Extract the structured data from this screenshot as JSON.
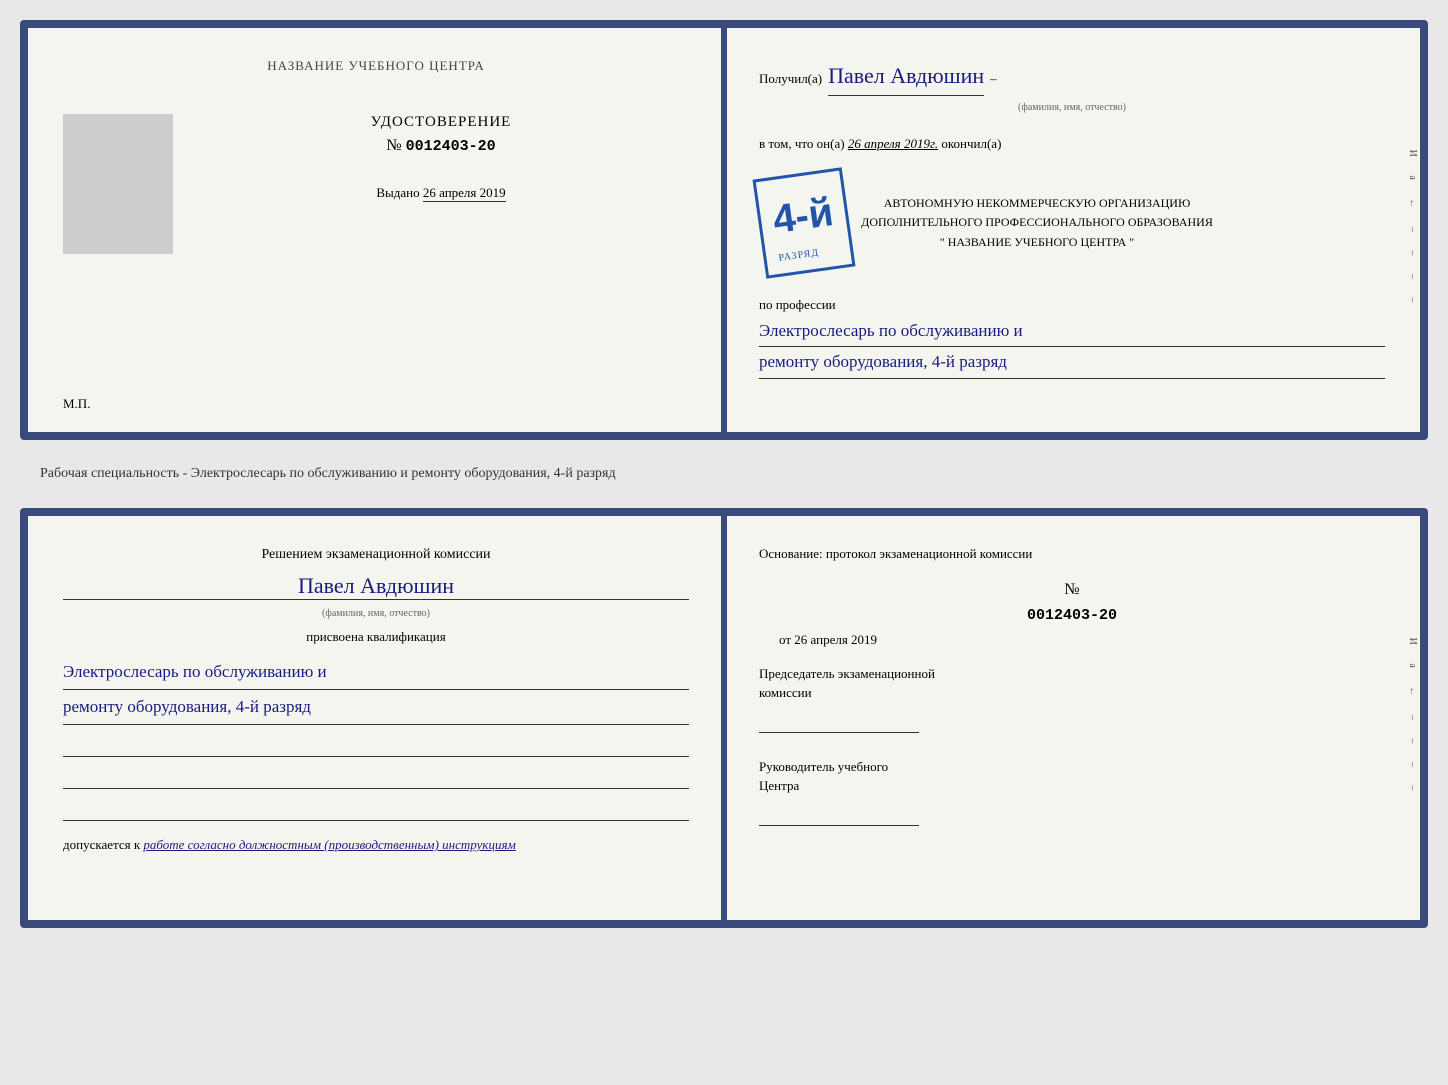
{
  "top_doc": {
    "left": {
      "title": "НАЗВАНИЕ УЧЕБНОГО ЦЕНТРА",
      "doc_type": "УДОСТОВЕРЕНИЕ",
      "doc_number_prefix": "№",
      "doc_number": "0012403-20",
      "vydano_label": "Выдано",
      "vydano_date": "26 апреля 2019",
      "mp_label": "М.П."
    },
    "right": {
      "poluchil_prefix": "Получил(a)",
      "recipient_name": "Павел Авдюшин",
      "fio_caption": "(фамилия, имя, отчество)",
      "vtom_prefix": "в том, что он(а)",
      "vtom_date": "26 апреля 2019г.",
      "okonchil": "окончил(а)",
      "stamp_number": "4-й",
      "stamp_suffix": "разряд",
      "org_line1": "АВТОНОМНУЮ НЕКОММЕРЧЕСКУЮ ОРГАНИЗАЦИЮ",
      "org_line2": "ДОПОЛНИТЕЛЬНОГО ПРОФЕССИОНАЛЬНОГО ОБРАЗОВАНИЯ",
      "org_line3": "\" НАЗВАНИЕ УЧЕБНОГО ЦЕНТРА \"",
      "po_professii_label": "по профессии",
      "profession_line1": "Электрослесарь по обслуживанию и",
      "profession_line2": "ремонту оборудования, 4-й разряд"
    }
  },
  "middle": {
    "text": "Рабочая специальность - Электрослесарь по обслуживанию и ремонту оборудования, 4-й разряд"
  },
  "bottom_doc": {
    "left": {
      "resheniem_line1": "Решением экзаменационной комиссии",
      "recipient_name": "Павел Авдюшин",
      "fio_caption": "(фамилия, имя, отчество)",
      "prisvoena_label": "присвоена квалификация",
      "qual_line1": "Электрослесарь по обслуживанию и",
      "qual_line2": "ремонту оборудования, 4-й разряд",
      "dopuskaetsya_prefix": "допускается к",
      "dopuskaetsya_value": "работе согласно должностным (производственным) инструкциям"
    },
    "right": {
      "osnovanie_label": "Основание: протокол экзаменационной комиссии",
      "protocol_prefix": "№",
      "protocol_number": "0012403-20",
      "ot_prefix": "от",
      "ot_date": "26 апреля 2019",
      "chairman_line1": "Председатель экзаменационной",
      "chairman_line2": "комиссии",
      "rukovoditel_line1": "Руководитель учебного",
      "rukovoditel_line2": "Центра"
    }
  },
  "edge_labels": {
    "letters": "И а ← – – – – –"
  }
}
